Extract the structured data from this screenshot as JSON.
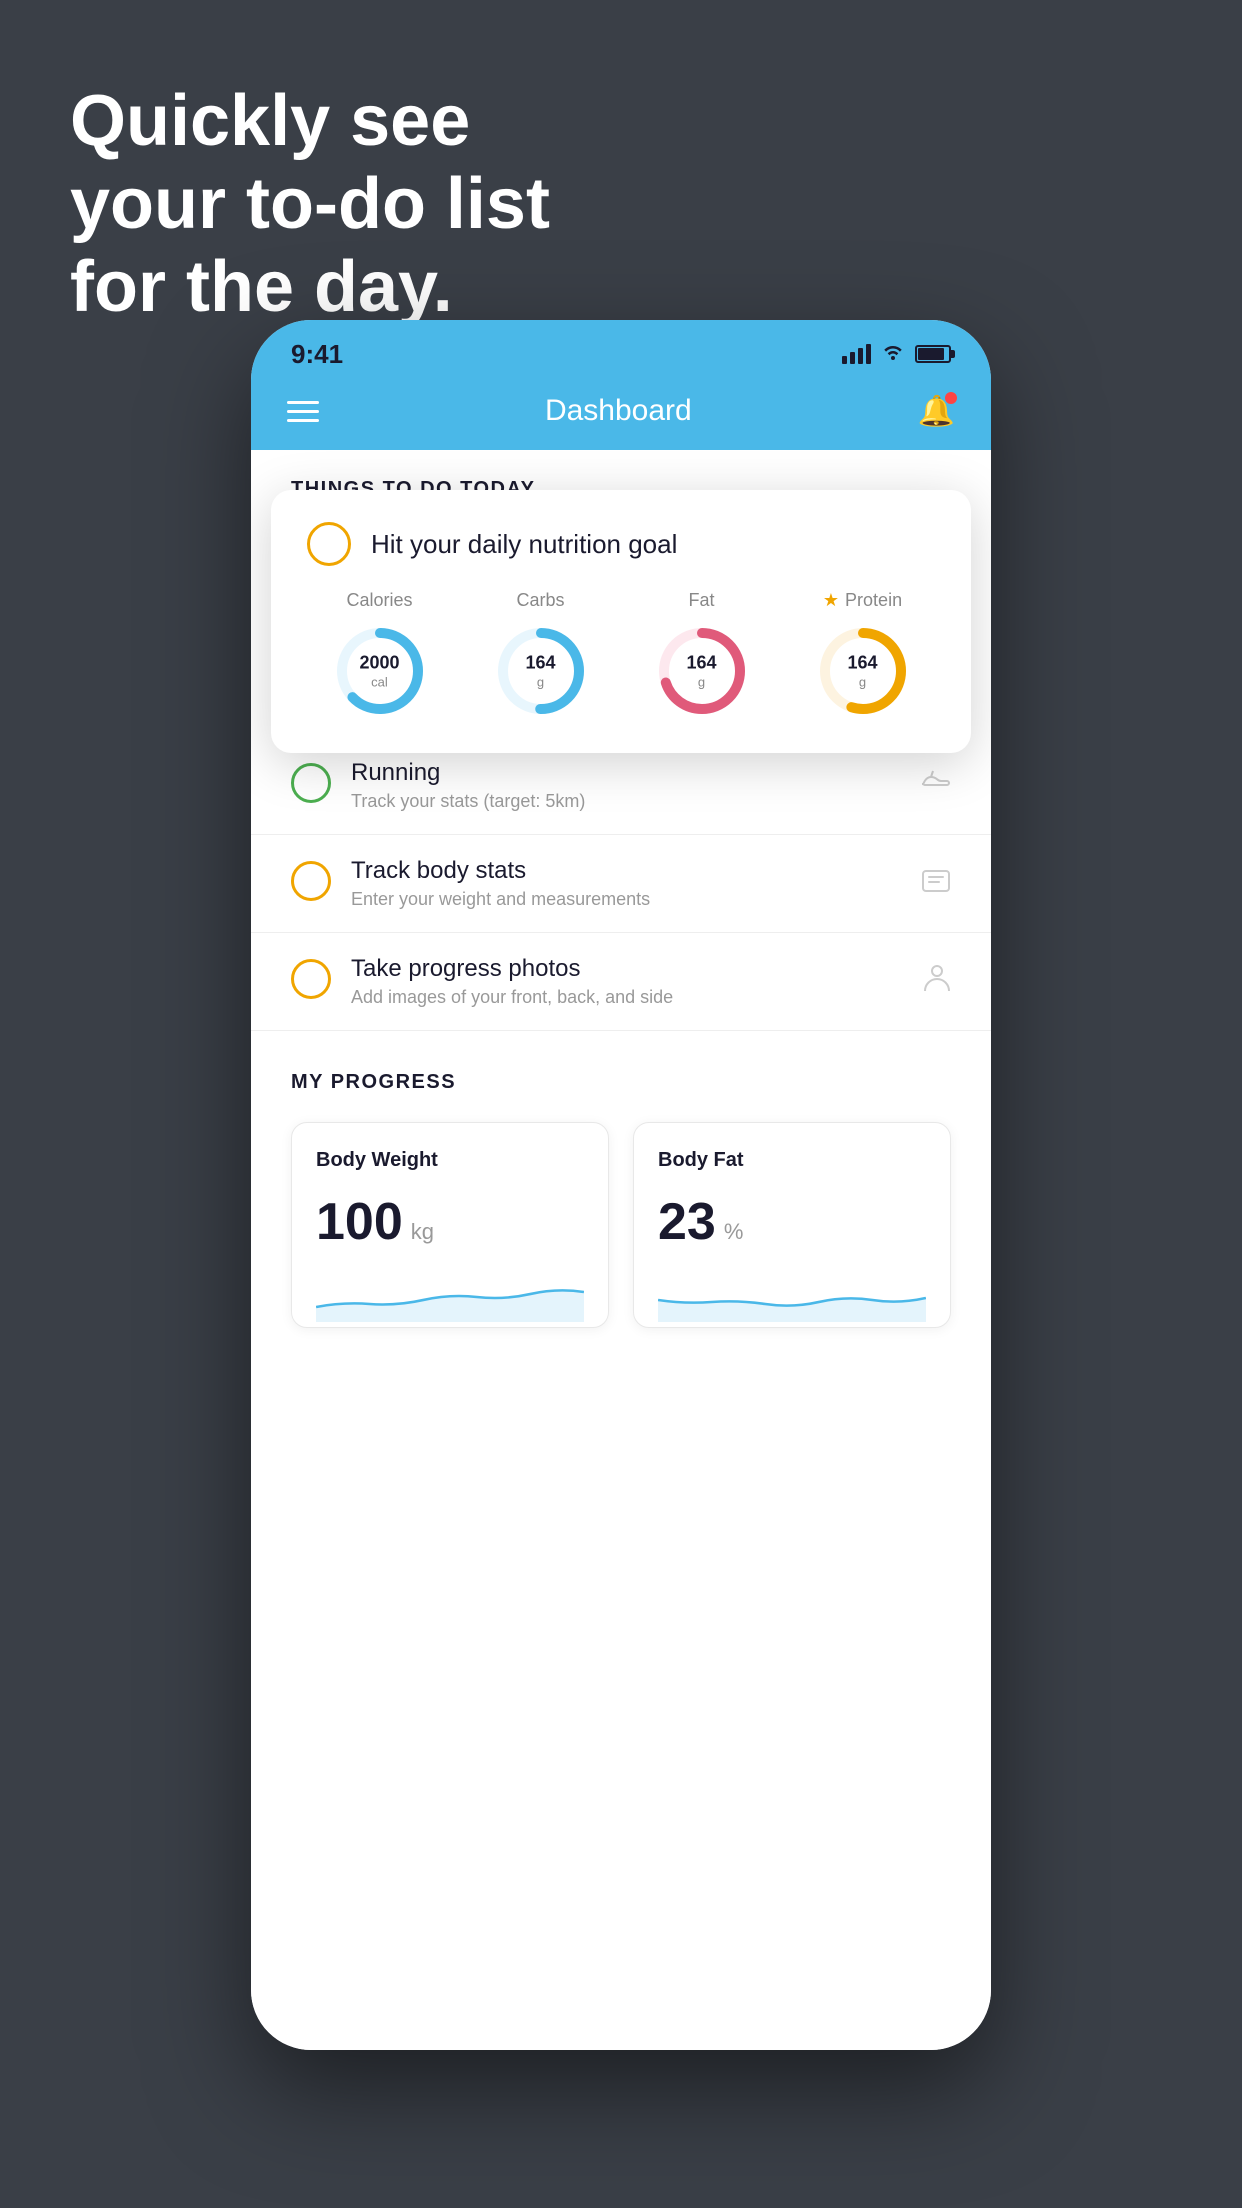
{
  "background": {
    "color": "#3a3f47"
  },
  "hero": {
    "line1": "Quickly see",
    "line2": "your to-do list",
    "line3": "for the day."
  },
  "status_bar": {
    "time": "9:41",
    "signal": "signal",
    "wifi": "wifi",
    "battery": "battery"
  },
  "nav": {
    "title": "Dashboard",
    "menu_label": "menu",
    "bell_label": "notification"
  },
  "things_header": "THINGS TO DO TODAY",
  "floating_card": {
    "title": "Hit your daily nutrition goal",
    "circle_color": "#f0a500",
    "nutrition": [
      {
        "label": "Calories",
        "value": "2000",
        "unit": "cal",
        "color": "#4ab8e8",
        "progress": 0.65,
        "starred": false
      },
      {
        "label": "Carbs",
        "value": "164",
        "unit": "g",
        "color": "#4ab8e8",
        "progress": 0.5,
        "starred": false
      },
      {
        "label": "Fat",
        "value": "164",
        "unit": "g",
        "color": "#e05a7a",
        "progress": 0.7,
        "starred": false
      },
      {
        "label": "Protein",
        "value": "164",
        "unit": "g",
        "color": "#f0a500",
        "progress": 0.55,
        "starred": true
      }
    ]
  },
  "todo_items": [
    {
      "id": "running",
      "title": "Running",
      "subtitle": "Track your stats (target: 5km)",
      "circle_color": "green",
      "icon": "shoe"
    },
    {
      "id": "body-stats",
      "title": "Track body stats",
      "subtitle": "Enter your weight and measurements",
      "circle_color": "yellow",
      "icon": "scale"
    },
    {
      "id": "progress-photos",
      "title": "Take progress photos",
      "subtitle": "Add images of your front, back, and side",
      "circle_color": "yellow",
      "icon": "person"
    }
  ],
  "progress": {
    "header": "MY PROGRESS",
    "cards": [
      {
        "id": "body-weight",
        "title": "Body Weight",
        "value": "100",
        "unit": "kg"
      },
      {
        "id": "body-fat",
        "title": "Body Fat",
        "value": "23",
        "unit": "%"
      }
    ]
  }
}
